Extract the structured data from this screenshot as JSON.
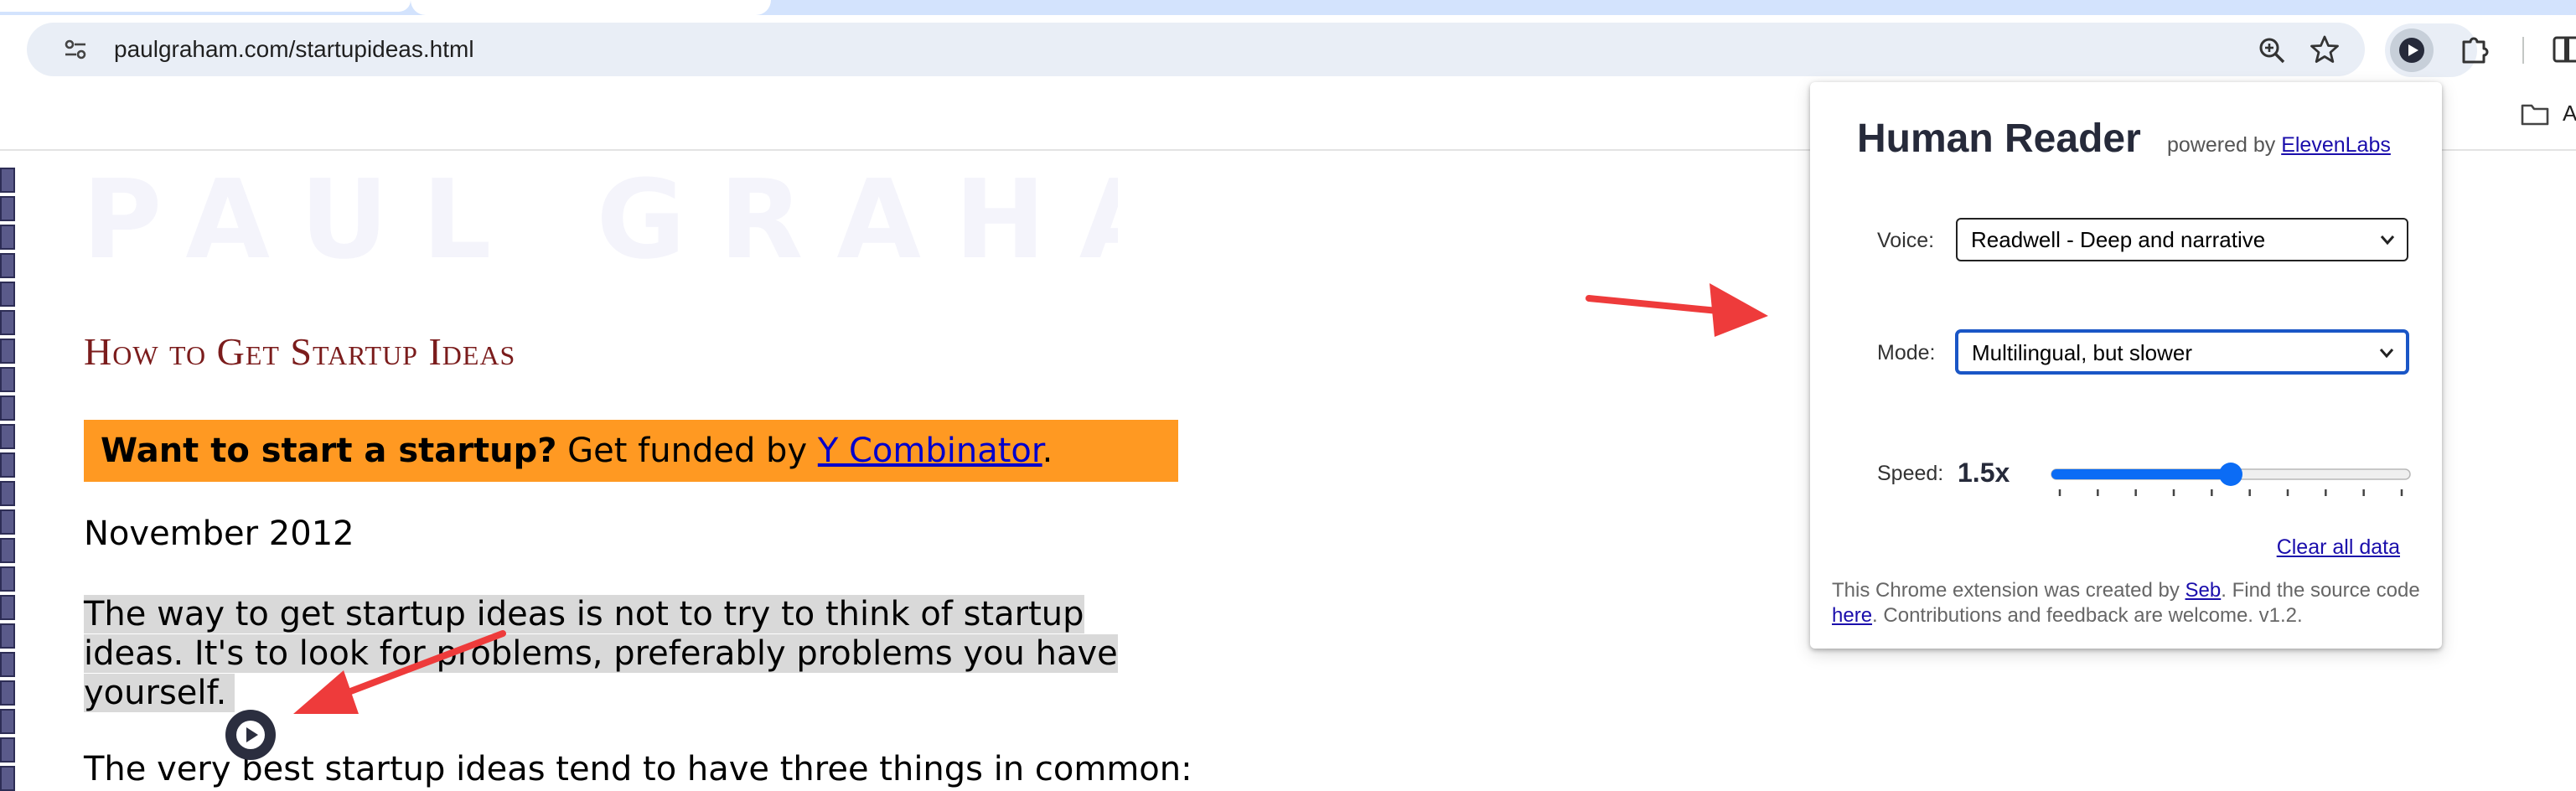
{
  "browser": {
    "url_host": "paulgraham.com",
    "url_path": "/startupideas.html",
    "bookmark_label": "A"
  },
  "page": {
    "logo_text": "PAUL GRAHAM",
    "title": "How to Get Startup Ideas",
    "banner": {
      "bold": "Want to start a startup?",
      "text": " Get funded by ",
      "link": "Y Combinator",
      "end": "."
    },
    "date": "November 2012",
    "para1": "The way to get startup ideas is not to try to think of startup ideas. It's to look for problems, preferably problems you have yourself.",
    "para2": "The very best startup ideas tend to have three things in common:"
  },
  "popup": {
    "title": "Human Reader",
    "powered_by": "powered by",
    "powered_link": "ElevenLabs",
    "voice_label": "Voice:",
    "voice_value": "Readwell - Deep and narrative",
    "mode_label": "Mode:",
    "mode_value": "Multilingual, but slower",
    "speed_label": "Speed:",
    "speed_value": "1.5x",
    "speed_fraction": 0.5,
    "clear_link": "Clear all data",
    "footer": {
      "t1": "This Chrome extension was created by ",
      "link1": "Seb",
      "t2": ". Find the source code ",
      "link2": "here",
      "t3": ". Contributions and feedback are welcome. v1.2."
    }
  },
  "colors": {
    "banner": "#ff9922",
    "title": "#7b1c1c",
    "slider_accent": "#0b6cf5",
    "arrow": "#ee3b3b"
  },
  "icons": [
    "site-info-icon",
    "zoom-icon",
    "bookmark-star-icon",
    "play-icon",
    "puzzle-icon",
    "side-panel-icon",
    "folder-icon",
    "chevron-down-icon"
  ]
}
